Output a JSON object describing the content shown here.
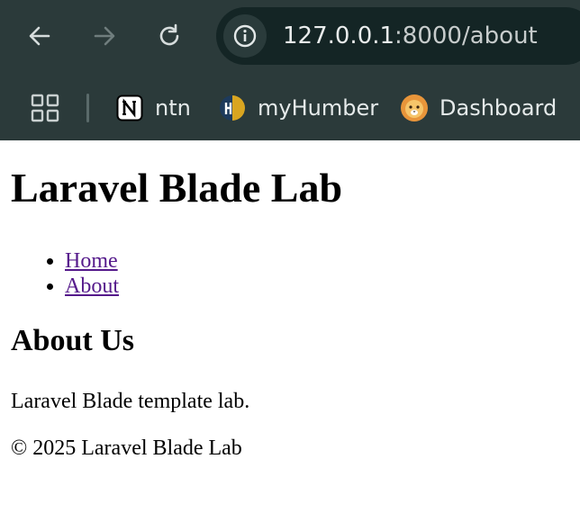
{
  "browser": {
    "url_host": "127.0.0.1",
    "url_rest": ":8000/about",
    "bookmarks": [
      {
        "label": "ntn",
        "icon": "notion-icon"
      },
      {
        "label": "myHumber",
        "icon": "myhumber-icon"
      },
      {
        "label": "Dashboard",
        "icon": "lion-icon"
      }
    ]
  },
  "page": {
    "site_title": "Laravel Blade Lab",
    "nav": [
      {
        "label": "Home"
      },
      {
        "label": "About"
      }
    ],
    "heading": "About Us",
    "description": "Laravel Blade template lab.",
    "footer": "© 2025 Laravel Blade Lab"
  },
  "colors": {
    "chrome_bg": "#2b3a3a",
    "omnibox_bg": "#142525",
    "visited_link": "#551a8b"
  }
}
